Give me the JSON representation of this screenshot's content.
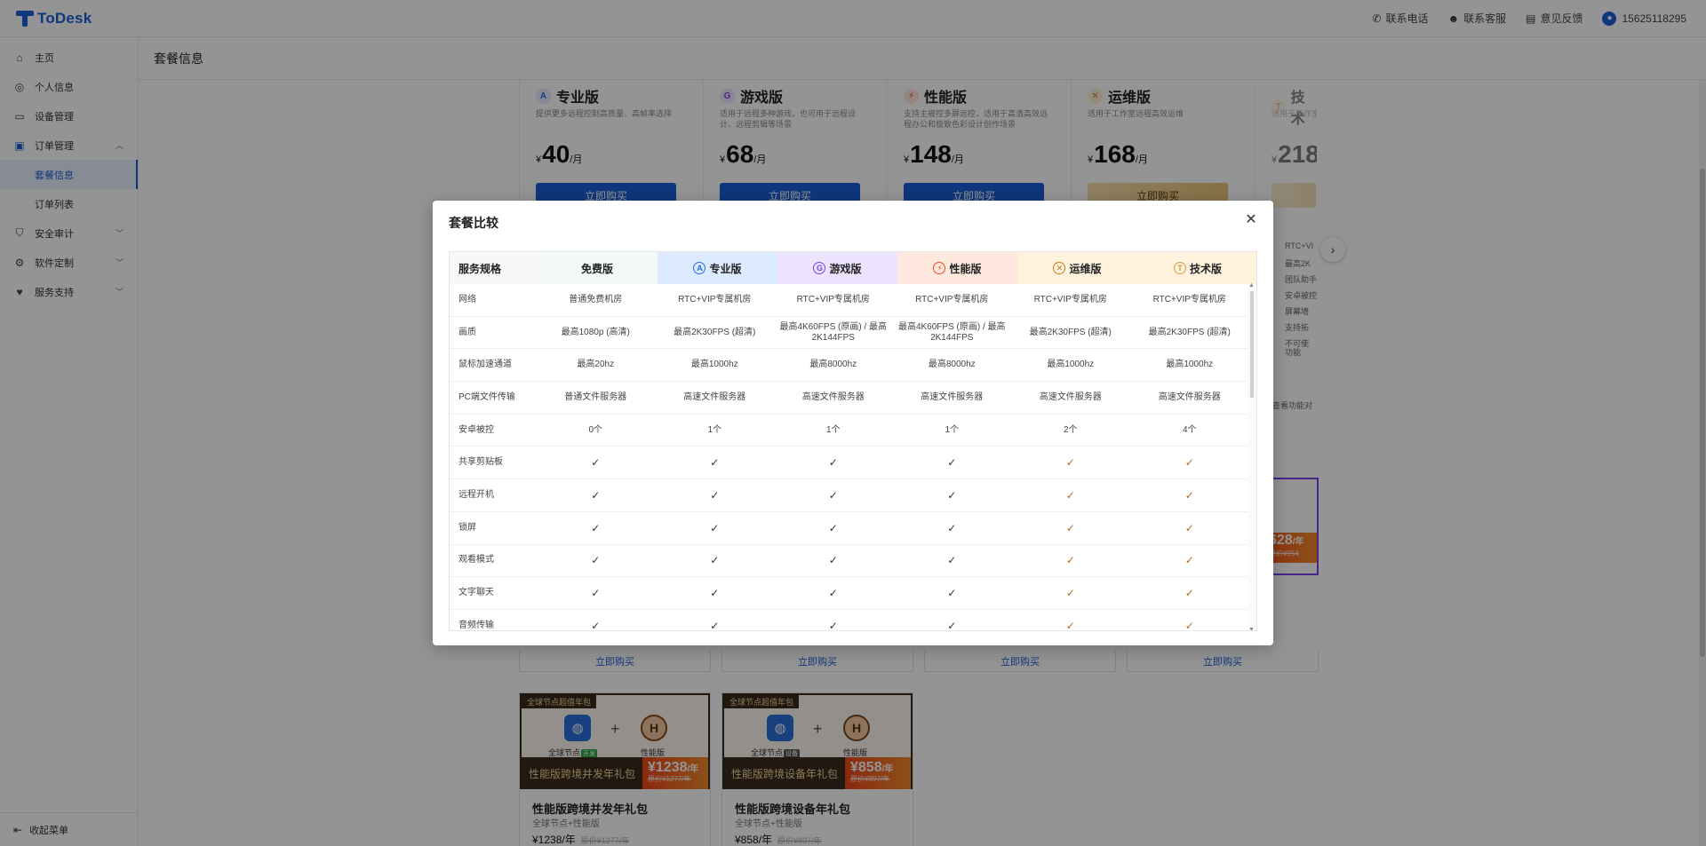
{
  "app": {
    "logo_text": "ToDesk",
    "top_actions": [
      {
        "icon": "phone-icon",
        "label": "联系电话"
      },
      {
        "icon": "support-icon",
        "label": "联系客服"
      },
      {
        "icon": "feedback-icon",
        "label": "意见反馈"
      }
    ],
    "user_phone": "15625118295"
  },
  "sidebar": {
    "items": [
      {
        "icon": "home-icon",
        "label": "主页"
      },
      {
        "icon": "user-icon",
        "label": "个人信息"
      },
      {
        "icon": "device-icon",
        "label": "设备管理"
      },
      {
        "icon": "order-icon",
        "label": "订单管理"
      },
      {
        "label": "套餐信息"
      },
      {
        "label": "订单列表"
      },
      {
        "icon": "shield-icon",
        "label": "安全审计"
      },
      {
        "icon": "customize-icon",
        "label": "软件定制"
      },
      {
        "icon": "heart-icon",
        "label": "服务支持"
      }
    ],
    "collapse_label": "收起菜单"
  },
  "page": {
    "title": "套餐信息"
  },
  "plans": [
    {
      "name": "专业版",
      "desc": "提供更多远程控制高质量、高帧率选择",
      "currency": "¥",
      "price": "40",
      "unit": "/月",
      "buy": "立即购买",
      "color": "#2d6bdc",
      "icon": "pro-icon"
    },
    {
      "name": "游戏版",
      "desc": "适用于远程多种游戏，也可用于远程设计、远程剪辑等场景",
      "currency": "¥",
      "price": "68",
      "unit": "/月",
      "buy": "立即购买",
      "color": "#7b42e8",
      "icon": "game-icon"
    },
    {
      "name": "性能版",
      "desc": "支持主被控多屏远控，适用于高清高效远程办公和极致色彩设计创作场景",
      "currency": "¥",
      "price": "148",
      "unit": "/月",
      "buy": "立即购买",
      "color": "#ee6a1f",
      "icon": "performance-icon"
    },
    {
      "name": "运维版",
      "desc": "适用于工作室远程高效运维",
      "currency": "¥",
      "price": "168",
      "unit": "/月",
      "buy": "立即购买",
      "color": "#c9781c",
      "icon": "ops-icon"
    },
    {
      "name": "技术",
      "desc": "适用于工作室",
      "currency": "¥",
      "price": "218",
      "unit": "",
      "buy": "",
      "color": "#d39a3a",
      "icon": "tech-icon"
    }
  ],
  "side_features": [
    "RTC+VI",
    "最高2K",
    "团队助手",
    "安卓被控",
    "屏幕墙",
    "支持拓",
    "不可使",
    "功能",
    "查看功能对"
  ],
  "purple_card": {
    "price": "628",
    "unit": "/年",
    "orig": "原价¥954"
  },
  "mini_buy": "立即购买",
  "bundles": [
    {
      "tag": "全球节点超值年包",
      "left_label": "全球节点",
      "left_badge": "开发",
      "right_label": "性能版",
      "banner_name": "性能版跨境并发年礼包",
      "price": "1238",
      "unit": "/年",
      "orig": "原价¥1277/年",
      "name": "性能版跨境并发年礼包",
      "sub": "全球节点+性能版",
      "price_row": "¥1238/年",
      "price_row_orig": "原价¥1277/年"
    },
    {
      "tag": "全球节点超值年包",
      "left_label": "全球节点",
      "left_badge": "设备",
      "right_label": "性能版",
      "banner_name": "性能版跨境设备年礼包",
      "price": "858",
      "unit": "/年",
      "orig": "原价¥897/年",
      "name": "性能版跨境设备年礼包",
      "sub": "全球节点+性能版",
      "price_row": "¥858/年",
      "price_row_orig": "原价¥897/年"
    }
  ],
  "modal": {
    "title": "套餐比较",
    "headers": [
      {
        "label": "服务规格",
        "bg": "#f7f7f7"
      },
      {
        "label": "免费版",
        "bg": "#f3faf5"
      },
      {
        "label": "专业版",
        "bg": "#dcebff",
        "icon": "pro-icon",
        "icon_color": "#2d6bdc",
        "icon_glyph": "A"
      },
      {
        "label": "游戏版",
        "bg": "#ece3ff",
        "icon": "game-icon",
        "icon_color": "#7b42e8",
        "icon_glyph": "G"
      },
      {
        "label": "性能版",
        "bg": "#ffe8dd",
        "icon": "performance-icon",
        "icon_color": "#ee4a1f",
        "icon_glyph": "⚡"
      },
      {
        "label": "运维版",
        "bg": "#fff2dc",
        "icon": "ops-icon",
        "icon_color": "#c9781c",
        "icon_glyph": "✕"
      },
      {
        "label": "技术版",
        "bg": "#fff3e0",
        "icon": "tech-icon",
        "icon_color": "#d39a3a",
        "icon_glyph": "T"
      }
    ],
    "rows": [
      {
        "label": "网络",
        "cells": [
          "普通免费机房",
          "RTC+VIP专属机房",
          "RTC+VIP专属机房",
          "RTC+VIP专属机房",
          "RTC+VIP专属机房",
          "RTC+VIP专属机房"
        ]
      },
      {
        "label": "画质",
        "cells": [
          "最高1080p (高清)",
          "最高2K30FPS (超清)",
          "最高4K60FPS (原画) / 最高2K144FPS",
          "最高4K60FPS (原画) / 最高2K144FPS",
          "最高2K30FPS (超清)",
          "最高2K30FPS (超清)"
        ]
      },
      {
        "label": "鼠标加速通道",
        "cells": [
          "最高20hz",
          "最高1000hz",
          "最高8000hz",
          "最高8000hz",
          "最高1000hz",
          "最高1000hz"
        ]
      },
      {
        "label": "PC端文件传输",
        "cells": [
          "普通文件服务器",
          "高速文件服务器",
          "高速文件服务器",
          "高速文件服务器",
          "高速文件服务器",
          "高速文件服务器"
        ]
      },
      {
        "label": "安卓被控",
        "cells": [
          "0个",
          "1个",
          "1个",
          "1个",
          "2个",
          "4个"
        ]
      },
      {
        "label": "共享剪贴板",
        "cells": [
          "✓",
          "✓",
          "✓",
          "✓",
          "✓",
          "✓"
        ]
      },
      {
        "label": "远程开机",
        "cells": [
          "✓",
          "✓",
          "✓",
          "✓",
          "✓",
          "✓"
        ]
      },
      {
        "label": "锁屏",
        "cells": [
          "✓",
          "✓",
          "✓",
          "✓",
          "✓",
          "✓"
        ]
      },
      {
        "label": "观看模式",
        "cells": [
          "✓",
          "✓",
          "✓",
          "✓",
          "✓",
          "✓"
        ]
      },
      {
        "label": "文字聊天",
        "cells": [
          "✓",
          "✓",
          "✓",
          "✓",
          "✓",
          "✓"
        ]
      },
      {
        "label": "音频传输",
        "cells": [
          "✓",
          "✓",
          "✓",
          "✓",
          "✓",
          "✓"
        ]
      }
    ]
  }
}
